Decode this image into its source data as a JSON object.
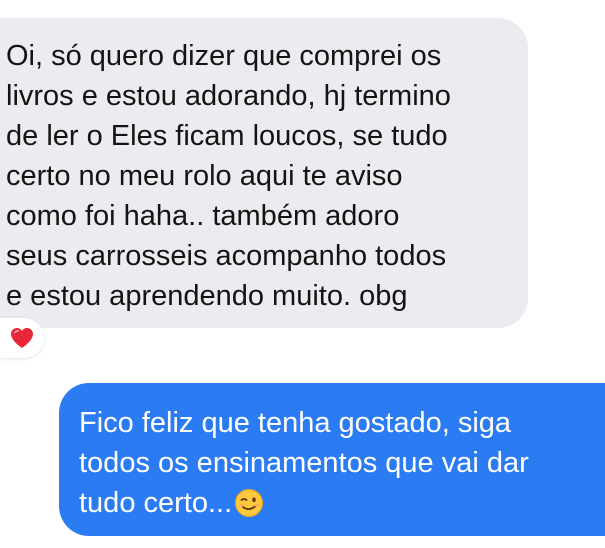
{
  "conversation": {
    "incoming": {
      "lines": [
        "Oi, só quero dizer que comprei os",
        "livros e estou adorando, hj termino",
        "de ler o Eles ficam loucos, se tudo",
        "certo no meu rolo aqui te aviso",
        "como foi haha.. também adoro",
        "seus carrosseis acompanho todos",
        "e estou aprendendo muito. obg"
      ],
      "reaction": "red-heart-icon"
    },
    "outgoing": {
      "lines": [
        "Fico feliz que tenha gostado, siga",
        "todos os ensinamentos que vai dar",
        "tudo certo..."
      ],
      "trailing_emoji": "winking-face-icon"
    }
  },
  "colors": {
    "incoming_bubble": "#ececf0",
    "outgoing_bubble": "#2b7bf2",
    "incoming_text": "#141414",
    "outgoing_text": "#ffffff",
    "heart": "#e8283a"
  }
}
